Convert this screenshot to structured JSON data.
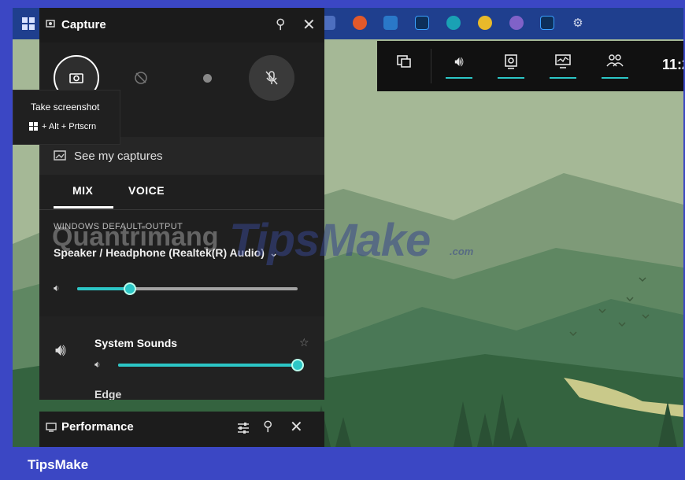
{
  "capture_panel": {
    "title": "Capture",
    "see_captures": "See my captures",
    "tabs": [
      "MIX",
      "VOICE"
    ],
    "output_label": "WINDOWS DEFAULT OUTPUT",
    "device": "Speaker / Headphone (Realtek(R) Audio)",
    "master_volume": 0.24,
    "system_sounds_label": "System Sounds",
    "system_sounds_volume": 1.0,
    "next_app": "Edge"
  },
  "tooltip": {
    "title": "Take screenshot",
    "shortcut": "+ Alt + Prtscrn"
  },
  "gamebar": {
    "time": "11:2"
  },
  "performance": {
    "title": "Performance"
  },
  "watermark": {
    "brand": "TipsMake",
    "suffix": ".com",
    "overlay": "Quantrimang"
  },
  "footer": {
    "label": "TipsMake"
  },
  "colors": {
    "accent": "#2cc6c6",
    "frame": "#3b47c4"
  }
}
